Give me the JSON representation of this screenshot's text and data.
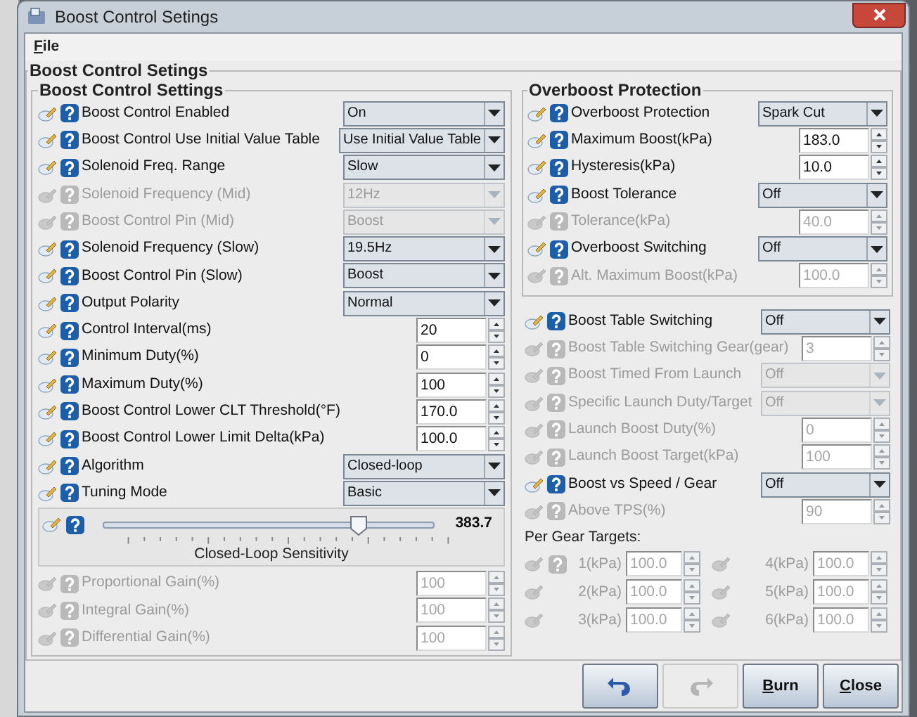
{
  "window": {
    "title": "Boost Control Setings"
  },
  "menu": [
    {
      "label": "File"
    }
  ],
  "main_group": {
    "title": "Boost Control Setings"
  },
  "left_group": {
    "title": "Boost Control Settings",
    "rows": [
      {
        "label": "Boost Control Enabled",
        "kind": "select",
        "value": "On",
        "enabled": true
      },
      {
        "label": "Boost Control Use Initial Value Table",
        "kind": "select",
        "value": "Use Initial Value Table",
        "enabled": true
      },
      {
        "label": "Solenoid Freq. Range",
        "kind": "select",
        "value": "Slow",
        "enabled": true
      },
      {
        "label": "Solenoid Frequency (Mid)",
        "kind": "select",
        "value": "12Hz",
        "enabled": false
      },
      {
        "label": "Boost Control Pin (Mid)",
        "kind": "select",
        "value": "Boost",
        "enabled": false
      },
      {
        "label": "Solenoid Frequency (Slow)",
        "kind": "select",
        "value": "19.5Hz",
        "enabled": true
      },
      {
        "label": "Boost Control Pin (Slow)",
        "kind": "select",
        "value": "Boost",
        "enabled": true
      },
      {
        "label": "Output Polarity",
        "kind": "select",
        "value": "Normal",
        "enabled": true
      },
      {
        "label": "Control Interval(ms)",
        "kind": "spinner",
        "value": "20",
        "enabled": true
      },
      {
        "label": "Minimum Duty(%)",
        "kind": "spinner",
        "value": "0",
        "enabled": true
      },
      {
        "label": "Maximum Duty(%)",
        "kind": "spinner",
        "value": "100",
        "enabled": true
      },
      {
        "label": "Boost Control Lower CLT Threshold(°F)",
        "kind": "spinner",
        "value": "170.0",
        "enabled": true
      },
      {
        "label": "Boost Control Lower Limit Delta(kPa)",
        "kind": "spinner",
        "value": "100.0",
        "enabled": true
      },
      {
        "label": "Algorithm",
        "kind": "select",
        "value": "Closed-loop",
        "enabled": true
      },
      {
        "label": "Tuning Mode",
        "kind": "select",
        "value": "Basic",
        "enabled": true
      }
    ],
    "slider": {
      "label": "Closed-Loop Sensitivity",
      "level": 0.775,
      "reading": "383.7"
    },
    "rows_after": [
      {
        "label": "Proportional Gain(%)",
        "kind": "spinner",
        "value": "100",
        "enabled": false
      },
      {
        "label": "Integral Gain(%)",
        "kind": "spinner",
        "value": "100",
        "enabled": false
      },
      {
        "label": "Differential Gain(%)",
        "kind": "spinner",
        "value": "100",
        "enabled": false
      }
    ]
  },
  "overboost": {
    "title": "Overboost Protection",
    "rows": [
      {
        "label": "Overboost Protection",
        "kind": "select",
        "value": "Spark Cut",
        "enabled": true
      },
      {
        "label": "Maximum Boost(kPa)",
        "kind": "spinner",
        "value": "183.0",
        "enabled": true
      },
      {
        "label": "Hysteresis(kPa)",
        "kind": "spinner",
        "value": "10.0",
        "enabled": true
      },
      {
        "label": "Boost Tolerance",
        "kind": "select",
        "value": "Off",
        "enabled": true
      },
      {
        "label": "Tolerance(kPa)",
        "kind": "spinner",
        "value": "40.0",
        "enabled": false
      },
      {
        "label": "Overboost Switching",
        "kind": "select",
        "value": "Off",
        "enabled": true
      },
      {
        "label": "Alt. Maximum Boost(kPa)",
        "kind": "spinner",
        "value": "100.0",
        "enabled": false
      }
    ]
  },
  "right_rows": [
    {
      "label": "Boost Table Switching",
      "kind": "select",
      "value": "Off",
      "enabled": true
    },
    {
      "label": "Boost Table Switching Gear(gear)",
      "kind": "spinner",
      "value": "3",
      "enabled": false
    },
    {
      "label": "Boost Timed From Launch",
      "kind": "select",
      "value": "Off",
      "enabled": false
    },
    {
      "label": "Specific Launch Duty/Target",
      "kind": "select",
      "value": "Off",
      "enabled": false
    },
    {
      "label": "Launch Boost Duty(%)",
      "kind": "spinner",
      "value": "0",
      "enabled": false
    },
    {
      "label": "Launch Boost Target(kPa)",
      "kind": "spinner",
      "value": "100",
      "enabled": false
    },
    {
      "label": "Boost vs Speed / Gear",
      "kind": "select",
      "value": "Off",
      "enabled": true
    },
    {
      "label": "Above TPS(%)",
      "kind": "spinner",
      "value": "90",
      "enabled": false
    }
  ],
  "per_gear": {
    "title": "Per Gear Targets:",
    "items": [
      {
        "label": "1(kPa)",
        "value": "100.0",
        "enabled": false,
        "help": true
      },
      {
        "label": "2(kPa)",
        "value": "100.0",
        "enabled": false,
        "help": false
      },
      {
        "label": "3(kPa)",
        "value": "100.0",
        "enabled": false,
        "help": false
      },
      {
        "label": "4(kPa)",
        "value": "100.0",
        "enabled": false,
        "help": false
      },
      {
        "label": "5(kPa)",
        "value": "100.0",
        "enabled": false,
        "help": false
      },
      {
        "label": "6(kPa)",
        "value": "100.0",
        "enabled": false,
        "help": false
      }
    ]
  },
  "buttons": [
    {
      "kind": "undo",
      "enabled": true
    },
    {
      "kind": "redo",
      "enabled": false
    },
    {
      "kind": "text",
      "label": "Burn",
      "enabled": true
    },
    {
      "kind": "text",
      "label": "Close",
      "enabled": true
    }
  ]
}
